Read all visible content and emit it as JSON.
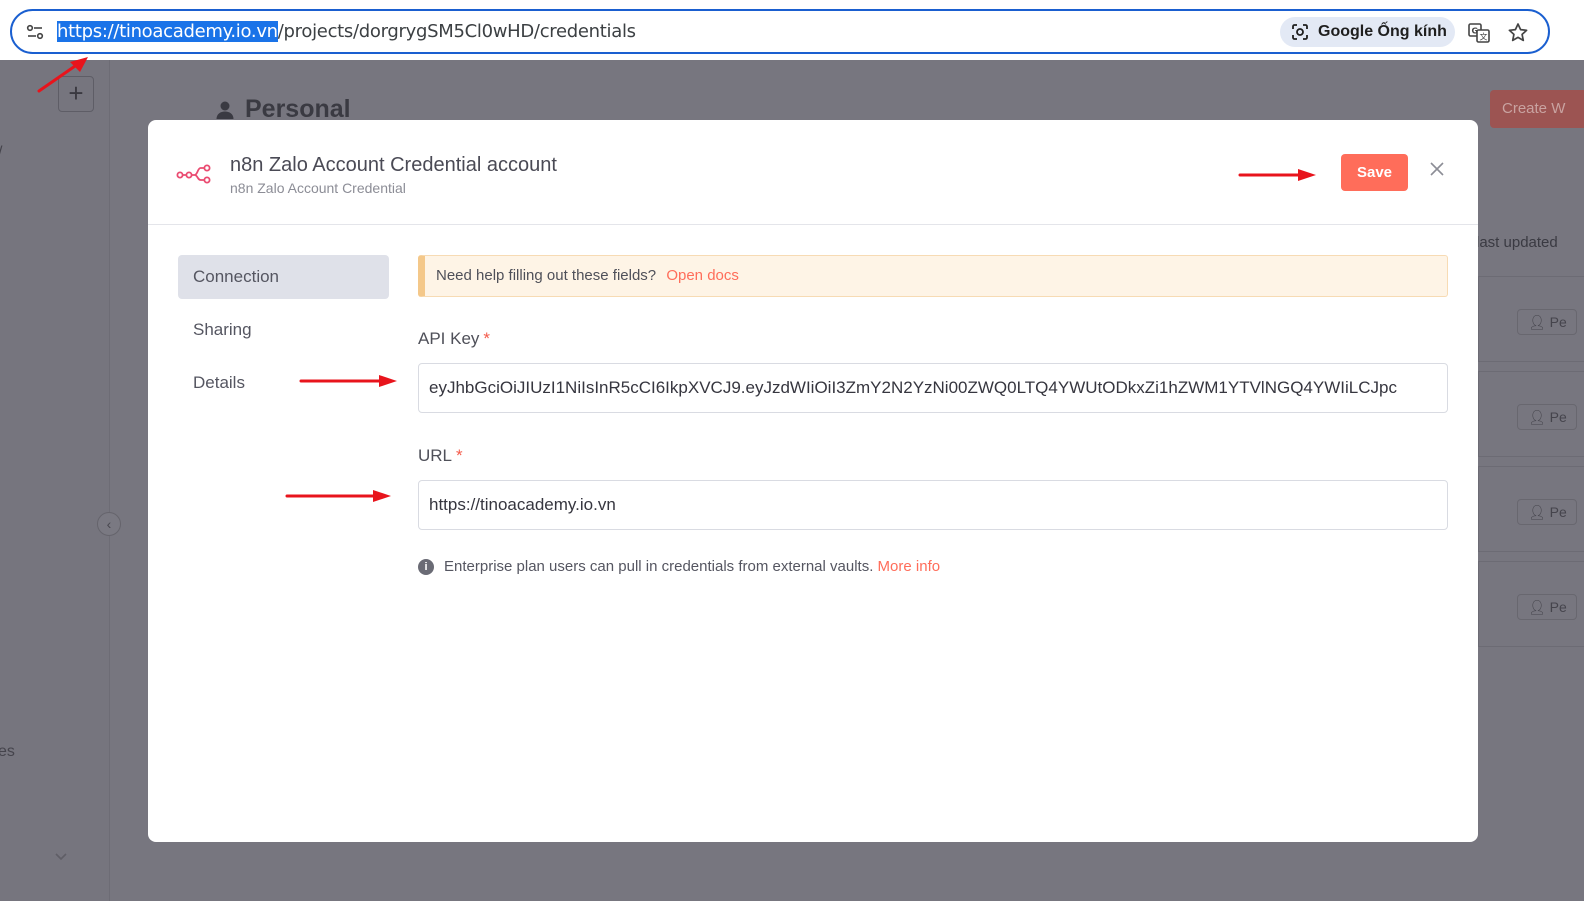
{
  "browser": {
    "url_host": "https://tinoacademy.io.vn",
    "url_path": "/projects/dorgrygSM5Cl0wHD/credentials",
    "lens_label": "Google Ống kính",
    "icons": [
      "site-info-icon",
      "google-lens-icon",
      "translate-icon",
      "bookmark-star-icon"
    ]
  },
  "background": {
    "page_title": "Personal",
    "create_button": "Create W",
    "sort_label": "last updated",
    "card_badge": "Pe",
    "sidebar_stub_top": "/",
    "sidebar_stub_bottom": "es"
  },
  "modal": {
    "title": "n8n Zalo Account Credential account",
    "subtitle": "n8n Zalo Account Credential",
    "save_label": "Save",
    "nav": {
      "connection": "Connection",
      "sharing": "Sharing",
      "details": "Details"
    },
    "help_text": "Need help filling out these fields?",
    "help_link": "Open docs",
    "api_key": {
      "label": "API Key",
      "required": "*",
      "value": "eyJhbGciOiJIUzI1NiIsInR5cCI6IkpXVCJ9.eyJzdWIiOiI3ZmY2N2YzNi00ZWQ0LTQ4YWUtODkxZi1hZWM1YTVlNGQ4YWIiLCJpc"
    },
    "url_field": {
      "label": "URL",
      "required": "*",
      "value": "https://tinoacademy.io.vn"
    },
    "info_text": "Enterprise plan users can pull in credentials from external vaults.",
    "info_link": "More info"
  },
  "colors": {
    "accent": "#ff6d5a",
    "annotation_arrow": "#e8141c",
    "omnibox_border": "#1a5fd0"
  }
}
